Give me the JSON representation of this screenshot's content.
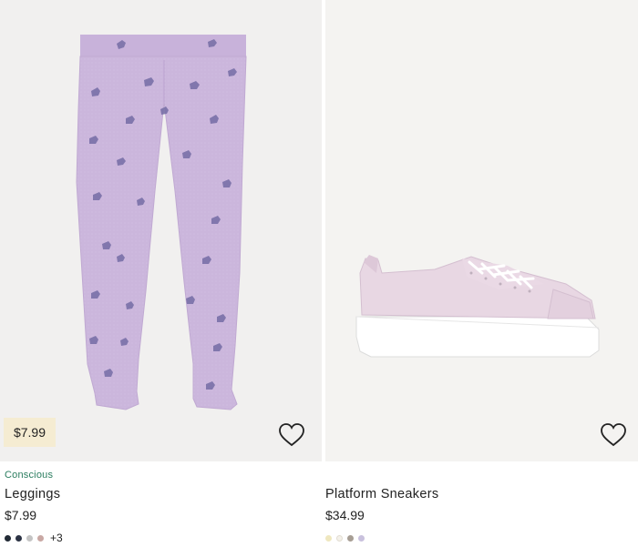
{
  "products": [
    {
      "name": "Leggings",
      "label": "Conscious",
      "price": "$7.99",
      "badge_price": "$7.99",
      "swatches": [
        "#222a35",
        "#2c3344",
        "#c4c4c4",
        "#c9a8a4"
      ],
      "more_colors": "+3",
      "favorite_icon": "heart-outline-icon"
    },
    {
      "name": "Platform Sneakers",
      "price": "$34.99",
      "swatches": [
        "#efe7bf",
        "#f4f1ea",
        "#a79e94",
        "#c9c1dd"
      ],
      "favorite_icon": "heart-outline-icon"
    }
  ],
  "colors": {
    "leggings_fabric": "#cbb6dc",
    "unicorn_print": "#7a71a8",
    "sneaker_upper": "#e8d7e3",
    "sustainability_label": "#2a7d5f",
    "price_badge_bg": "#f5ecd2"
  }
}
